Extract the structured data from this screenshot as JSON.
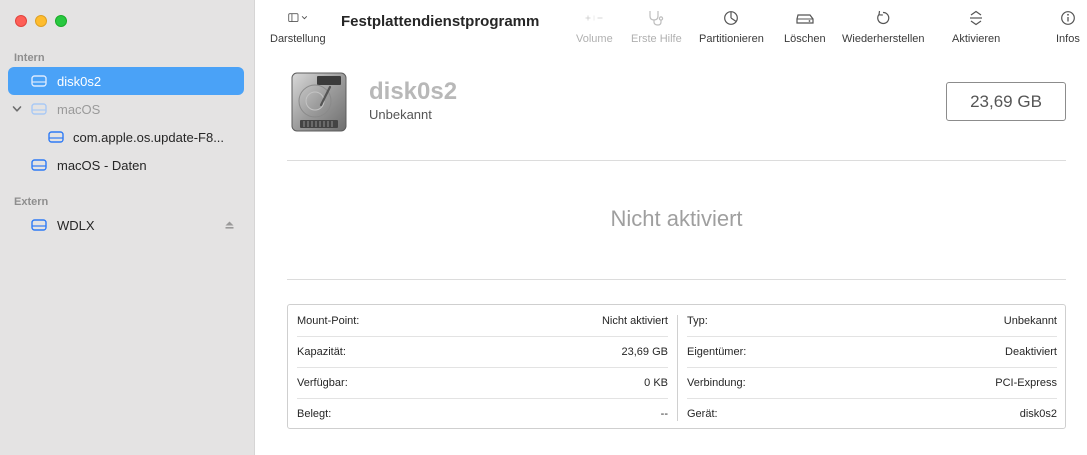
{
  "sidebar": {
    "sections": [
      {
        "label": "Intern"
      },
      {
        "label": "Extern"
      }
    ],
    "items": [
      {
        "label": "disk0s2",
        "selected": true
      },
      {
        "label": "macOS",
        "expanded": true
      },
      {
        "label": "com.apple.os.update-F8..."
      },
      {
        "label": "macOS - Daten"
      },
      {
        "label": "WDLX",
        "ejectable": true
      }
    ]
  },
  "toolbar": {
    "view_label": "Darstellung",
    "title": "Festplattendienstprogramm",
    "volume_label": "Volume",
    "firstaid_label": "Erste Hilfe",
    "partition_label": "Partitionieren",
    "erase_label": "Löschen",
    "restore_label": "Wiederherstellen",
    "mount_label": "Aktivieren",
    "info_label": "Infos"
  },
  "volume": {
    "name": "disk0s2",
    "subtitle": "Unbekannt",
    "size": "23,69 GB",
    "mount_status": "Nicht aktiviert"
  },
  "details": {
    "left": [
      {
        "key": "Mount-Point:",
        "value": "Nicht aktiviert"
      },
      {
        "key": "Kapazität:",
        "value": "23,69 GB"
      },
      {
        "key": "Verfügbar:",
        "value": "0 KB"
      },
      {
        "key": "Belegt:",
        "value": "--"
      }
    ],
    "right": [
      {
        "key": "Typ:",
        "value": "Unbekannt"
      },
      {
        "key": "Eigentümer:",
        "value": "Deaktiviert"
      },
      {
        "key": "Verbindung:",
        "value": "PCI-Express"
      },
      {
        "key": "Gerät:",
        "value": "disk0s2"
      }
    ]
  },
  "colors": {
    "selection": "#4aa2f7",
    "sidebar_bg": "#e4e3e3",
    "disk_icon_blue": "#2f7bf5"
  }
}
